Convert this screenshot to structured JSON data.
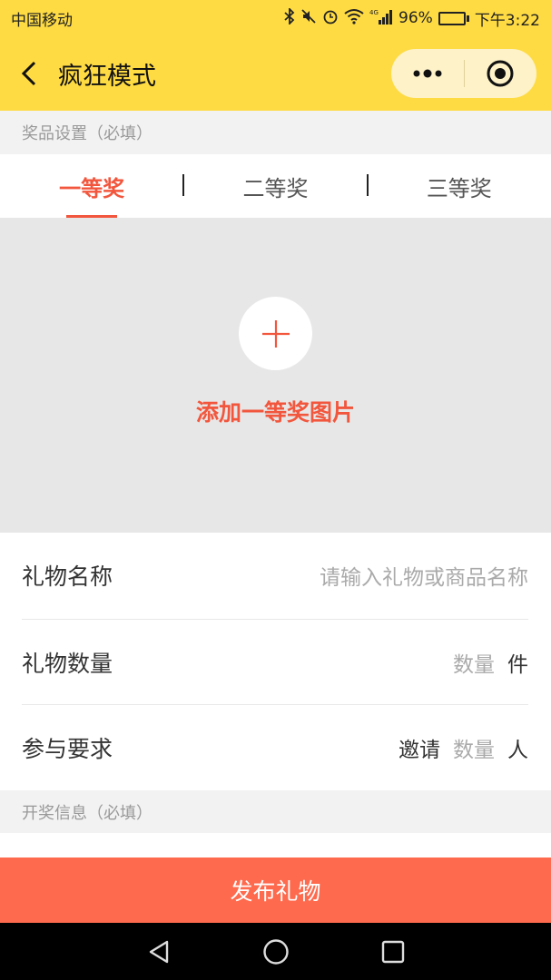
{
  "status": {
    "carrier": "中国移动",
    "network": "4G",
    "battery": "96%",
    "battery_level": 0.96,
    "time": "下午3:22",
    "icons": [
      "bluetooth-icon",
      "mute-icon",
      "alarm-icon",
      "wifi-icon",
      "signal-icon",
      "battery-icon"
    ]
  },
  "nav": {
    "title": "疯狂模式",
    "icons": [
      "back-icon",
      "more-icon",
      "close-target-icon"
    ]
  },
  "prize_section": {
    "header": "奖品设置（必填）",
    "tabs": [
      {
        "label": "一等奖",
        "active": true
      },
      {
        "label": "二等奖",
        "active": false
      },
      {
        "label": "三等奖",
        "active": false
      }
    ]
  },
  "upload": {
    "label": "添加一等奖图片",
    "icon": "plus-icon"
  },
  "form": {
    "gift_name": {
      "label": "礼物名称",
      "placeholder": "请输入礼物或商品名称"
    },
    "gift_qty": {
      "label": "礼物数量",
      "placeholder": "数量",
      "unit": "件"
    },
    "requirement": {
      "label": "参与要求",
      "prefix": "邀请",
      "placeholder": "数量",
      "unit": "人"
    }
  },
  "draw_section": {
    "header": "开奖信息（必填）"
  },
  "publish": {
    "label": "发布礼物"
  },
  "colors": {
    "brand_yellow": "#fedb43",
    "accent_red": "#f2563d",
    "button_orange": "#fe6a4d"
  }
}
